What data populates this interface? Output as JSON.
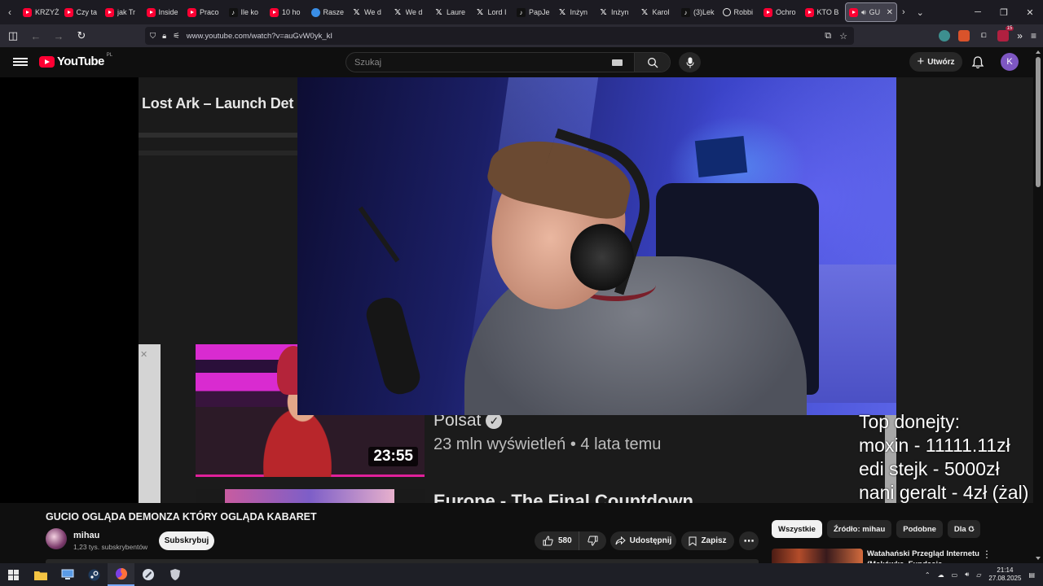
{
  "browser": {
    "tabs": [
      {
        "icon": "youtube-icon",
        "label": "KRZYŻ"
      },
      {
        "icon": "youtube-icon",
        "label": "Czy ta"
      },
      {
        "icon": "youtube-icon",
        "label": "jak Tr"
      },
      {
        "icon": "youtube-icon",
        "label": "Inside"
      },
      {
        "icon": "youtube-icon",
        "label": "Praco"
      },
      {
        "icon": "tiktok-icon",
        "label": "Ile ko"
      },
      {
        "icon": "youtube-icon",
        "label": "10 ho"
      },
      {
        "icon": "blue-circle-icon",
        "label": "Rasze"
      },
      {
        "icon": "x-icon",
        "label": "We d"
      },
      {
        "icon": "x-icon",
        "label": "We d"
      },
      {
        "icon": "x-icon",
        "label": "Laure"
      },
      {
        "icon": "x-icon",
        "label": "Lord I"
      },
      {
        "icon": "tiktok-icon",
        "label": "PapJe"
      },
      {
        "icon": "x-icon",
        "label": "Inżyn"
      },
      {
        "icon": "x-icon",
        "label": "Inżyn"
      },
      {
        "icon": "x-icon",
        "label": "Karol"
      },
      {
        "icon": "tiktok-icon",
        "label": "(3)Lek"
      },
      {
        "icon": "circle-icon",
        "label": "Robbi"
      },
      {
        "icon": "youtube-icon",
        "label": "Ochro"
      },
      {
        "icon": "youtube-icon",
        "label": "KTO B"
      }
    ],
    "active_tab": {
      "label": "GU",
      "close": "✕"
    },
    "url": "www.youtube.com/watch?v=auGvW0yk_kI",
    "extension_badge": "15"
  },
  "youtube": {
    "logo_word": "YouTube",
    "region": "PL",
    "search_placeholder": "Szukaj",
    "create_label": "Utwórz",
    "avatar_letter": "K"
  },
  "video": {
    "bg_title": "Lost Ark – Launch Det",
    "bg_channel": "Polsat",
    "bg_meta": "23 mln wyświetleń • 4 lata temu",
    "bg_next_title": "Europe - The Final Countdown",
    "bg_duration": "23:55",
    "donations": [
      "Top donejty:",
      "moxin - 11111.11zł",
      "edi stejk - 5000zł",
      "nani geralt - 4zł (żal)"
    ]
  },
  "watch": {
    "title": "GUCIO OGLĄDA DEMONZA KTÓRY OGLĄDA KABARET",
    "channel_name": "mihau",
    "subscribers": "1,23 tys. subskrybentów",
    "subscribe_label": "Subskrybuj",
    "likes": "580",
    "share_label": "Udostępnij",
    "save_label": "Zapisz"
  },
  "chips": [
    "Wszystkie",
    "Źródło: mihau",
    "Podobne",
    "Dla C"
  ],
  "recommendation": {
    "title": "Watahański Przegląd Internetu (Makówka, Fundacja"
  },
  "taskbar": {
    "time": "21:14",
    "date": "27.08.2025"
  },
  "colors": {
    "youtube_red": "#ff0033",
    "avatar_purple": "#7e57c2",
    "background": "#0f0f0f"
  }
}
